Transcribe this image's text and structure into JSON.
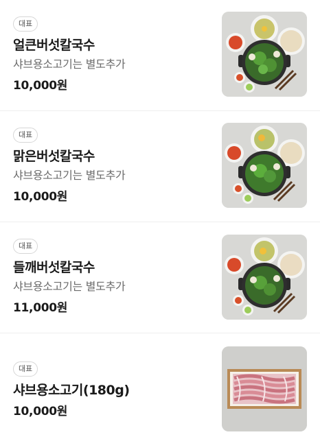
{
  "menu": {
    "items": [
      {
        "badge": "대표",
        "name": "얼큰버섯칼국수",
        "description": "샤브용소고기는 별도추가",
        "price": "10,000원",
        "image_icon": "hotpot-set-photo"
      },
      {
        "badge": "대표",
        "name": "맑은버섯칼국수",
        "description": "샤브용소고기는 별도추가",
        "price": "10,000원",
        "image_icon": "hotpot-set-photo"
      },
      {
        "badge": "대표",
        "name": "들깨버섯칼국수",
        "description": "샤브용소고기는 별도추가",
        "price": "11,000원",
        "image_icon": "hotpot-set-photo"
      },
      {
        "badge": "대표",
        "name": "샤브용소고기(180g)",
        "description": "",
        "price": "10,000원",
        "image_icon": "sliced-beef-photo"
      }
    ]
  },
  "colors": {
    "background": "#ffffff",
    "text_primary": "#1a1a1a",
    "text_secondary": "#6b6b6b",
    "badge_border": "#d6d6d6",
    "divider": "#eeeeee"
  }
}
